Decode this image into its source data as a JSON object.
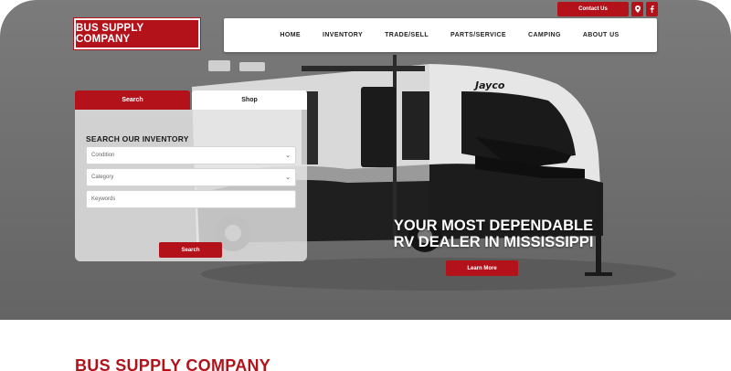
{
  "header": {
    "contact_label": "Contact Us",
    "logo_text": "BUS SUPPLY COMPANY"
  },
  "nav": {
    "items": [
      "HOME",
      "INVENTORY",
      "TRADE/SELL",
      "PARTS/SERVICE",
      "CAMPING",
      "ABOUT US"
    ]
  },
  "search_panel": {
    "tab_search": "Search",
    "tab_shop": "Shop",
    "title": "SEARCH OUR INVENTORY",
    "condition_placeholder": "Condition",
    "category_placeholder": "Category",
    "keywords_placeholder": "Keywords",
    "button_label": "Search"
  },
  "hero": {
    "headline_line1": "YOUR MOST DEPENDABLE",
    "headline_line2": "RV DEALER IN MISSISSIPPI",
    "button_label": "Learn More",
    "trailer_brand": "Jayco"
  },
  "section": {
    "title": "BUS SUPPLY COMPANY"
  },
  "icons": {
    "map_pin": "map-pin-icon",
    "facebook": "facebook-icon",
    "chevron": "chevron-down-icon"
  },
  "colors": {
    "brand_red": "#b3121b",
    "hero_gray": "#727272"
  }
}
